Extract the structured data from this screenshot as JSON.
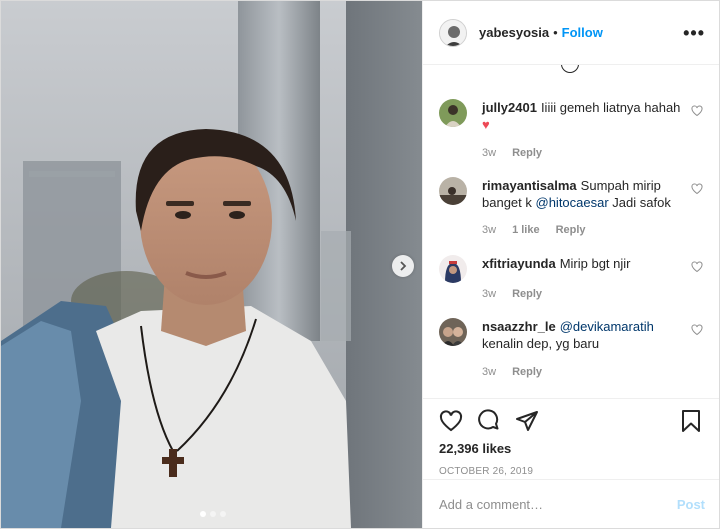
{
  "header": {
    "username": "yabesyosia",
    "separator": "•",
    "follow_label": "Follow",
    "more_label": "•••"
  },
  "comments": [
    {
      "username": "jully2401",
      "text": "Iiiii gemeh liatnya hahah",
      "emoji": "♥",
      "time": "3w",
      "likes": "",
      "reply": "Reply"
    },
    {
      "username": "rimayantisalma",
      "text_before": "Sumpah mirip banget k ",
      "mention": "@hitocaesar",
      "text_after": " Jadi safok",
      "time": "3w",
      "likes": "1 like",
      "reply": "Reply"
    },
    {
      "username": "xfitriayunda",
      "text": "Mirip bgt njir",
      "time": "3w",
      "likes": "",
      "reply": "Reply"
    },
    {
      "username": "nsaazzhr_le",
      "mention": "@devikamaratih",
      "text_after": " kenalin dep, yg baru",
      "time": "3w",
      "likes": "",
      "reply": "Reply"
    }
  ],
  "post": {
    "likes": "22,396 likes",
    "date": "OCTOBER 26, 2019"
  },
  "composer": {
    "placeholder": "Add a comment…",
    "post_label": "Post"
  },
  "carousel": {
    "total": 3,
    "active_index": 0
  },
  "colors": {
    "link": "#0095f6",
    "mention": "#00376b",
    "muted": "#8e8e8e",
    "post_disabled": "#b2dffc",
    "heart": "#ed4956"
  }
}
